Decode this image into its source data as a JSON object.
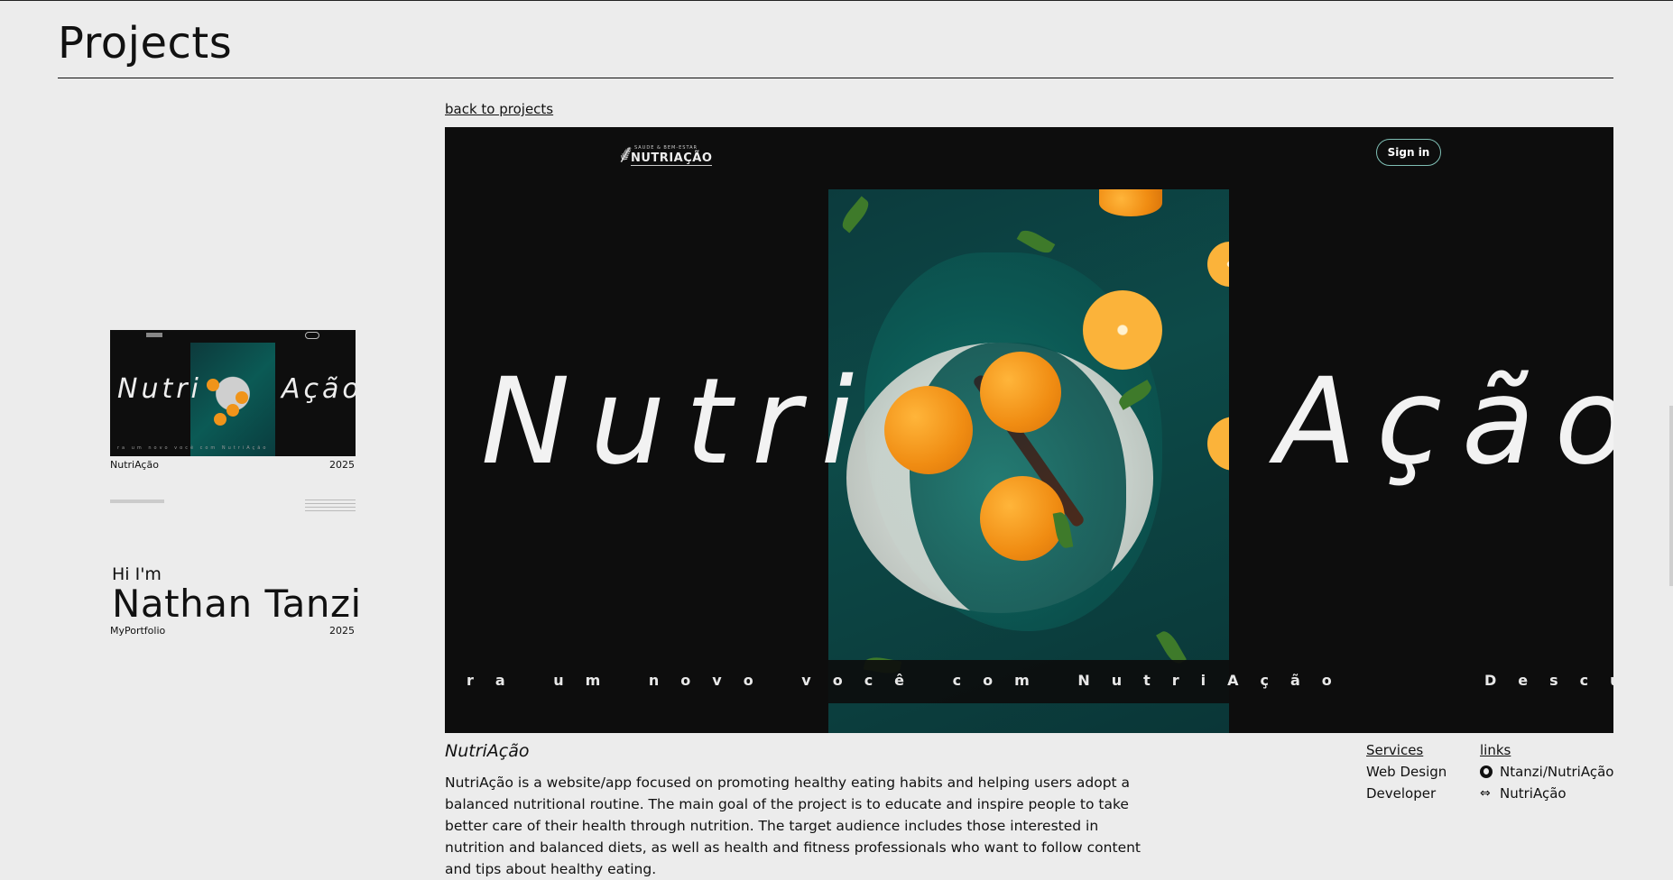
{
  "page": {
    "title": "Projects"
  },
  "projects_list": [
    {
      "name": "NutriAção",
      "year": "2025",
      "thumb_words": [
        "Nutri",
        "Ação"
      ]
    },
    {
      "name": "MyPortfolio",
      "year": "2025",
      "greeting": "Hi I'm",
      "owner": "Nathan Tanzi"
    }
  ],
  "detail": {
    "back_link": "back to projects",
    "hero": {
      "logo_small": "SAUDE & BEM-ESTAR",
      "logo_big": "NUTRIAÇÃO",
      "signin": "Sign in",
      "word_left": "Nutri",
      "word_right": "Ação",
      "marquee": "ra um novo você com NutriAção",
      "marquee_tail": "Descu"
    },
    "project_name": "NutriAção",
    "description": "NutriAção is a website/app focused on promoting healthy eating habits and helping users adopt a balanced nutritional routine. The main goal of the project is to educate and inspire people to take better care of their health through nutrition. The target audience includes those interested in nutrition and balanced diets, as well as health and fitness professionals who want to follow content and tips about healthy eating.",
    "services": {
      "heading": "Services",
      "items": [
        "Web Design",
        "Developer"
      ]
    },
    "links": {
      "heading": "links",
      "github": "Ntanzi/NutriAção",
      "site": "NutriAção"
    }
  },
  "icons": [
    "github-icon",
    "link-icon",
    "tree-logo-icon"
  ],
  "colors": {
    "background": "#ececec",
    "hero_bg": "#0d0d0d",
    "accent_teal": "#0c5a55",
    "orange": "#f0941a"
  }
}
